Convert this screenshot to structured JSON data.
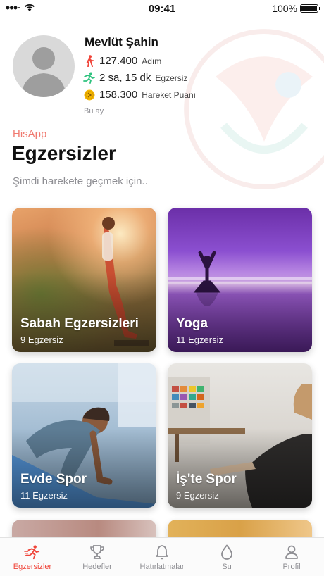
{
  "status_bar": {
    "time": "09:41",
    "battery": "100%",
    "battery_level": 1.0
  },
  "profile": {
    "name": "Mevlüt Şahin",
    "period": "Bu ay",
    "stats": [
      {
        "icon": "walking-icon",
        "value": "127.400",
        "unit": "Adım",
        "color": "#f0453a"
      },
      {
        "icon": "running-icon",
        "value": "2 sa, 15 dk",
        "unit": "Egzersiz",
        "color": "#2ec27e"
      },
      {
        "icon": "coin-icon",
        "value": "158.300",
        "unit": "Hareket Puanı",
        "color": "#f5b800"
      }
    ]
  },
  "header": {
    "app_name": "HisApp",
    "title": "Egzersizler",
    "subtitle": "Şimdi harekete geçmek için.."
  },
  "categories": [
    {
      "title": "Sabah Egzersizleri",
      "count": "9 Egzersiz"
    },
    {
      "title": "Yoga",
      "count": "11 Egzersiz"
    },
    {
      "title": "Evde Spor",
      "count": "11 Egzersiz"
    },
    {
      "title": "İş'te Spor",
      "count": "9 Egzersiz"
    }
  ],
  "tabs": [
    {
      "label": "Egzersizler",
      "icon": "running-icon",
      "active": true
    },
    {
      "label": "Hedefler",
      "icon": "trophy-icon",
      "active": false
    },
    {
      "label": "Hatırlatmalar",
      "icon": "bell-icon",
      "active": false
    },
    {
      "label": "Su",
      "icon": "water-drop-icon",
      "active": false
    },
    {
      "label": "Profil",
      "icon": "person-icon",
      "active": false
    }
  ],
  "colors": {
    "accent": "#f0453a",
    "app_label": "#f07a70",
    "muted": "#8e8e93"
  }
}
